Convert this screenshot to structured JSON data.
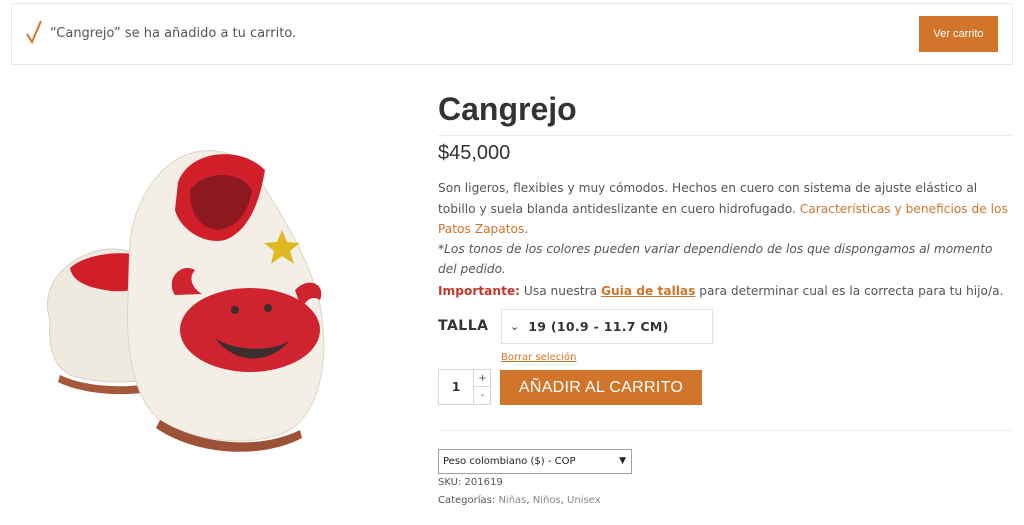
{
  "notice": {
    "message": "“Cangrejo” se ha añadido a tu carrito.",
    "view_cart_label": "Ver carrito",
    "icon": "check-icon",
    "accent_color": "#d0752a"
  },
  "product": {
    "title": "Cangrejo",
    "price": "$45,000",
    "description": "Son ligeros, flexibles y muy cómodos. Hechos en cuero con sistema de ajuste elástico al tobillo y suela blanda antideslizante en cuero hidrofugado. ",
    "description_link": "Características y beneficios de los Patos Zapatos",
    "description_end": ".",
    "note": "*Los tonos de los colores pueden variar dependiendo de los que dispongamos al momento del pedido.",
    "important_label": "Importante:",
    "important_text_1": " Usa nuestra ",
    "size_guide_link": "Guia de tallas",
    "important_text_2": " para determinar cual es la correcta para tu hijo/a."
  },
  "variation": {
    "label": "TALLA",
    "selected": "19 (10.9 - 11.7 CM)",
    "reset_label": "Borrar seleción"
  },
  "cart": {
    "quantity": "1",
    "plus": "+",
    "minus": "-",
    "add_label": "AÑADIR AL CARRITO"
  },
  "meta": {
    "currency_selected": "Peso colombiano ($) - COP",
    "sku_label": "SKU:",
    "sku_value": "201619",
    "categories_label": "Categorías:",
    "categories": [
      "Niñas",
      "Niños",
      "Unisex"
    ]
  }
}
